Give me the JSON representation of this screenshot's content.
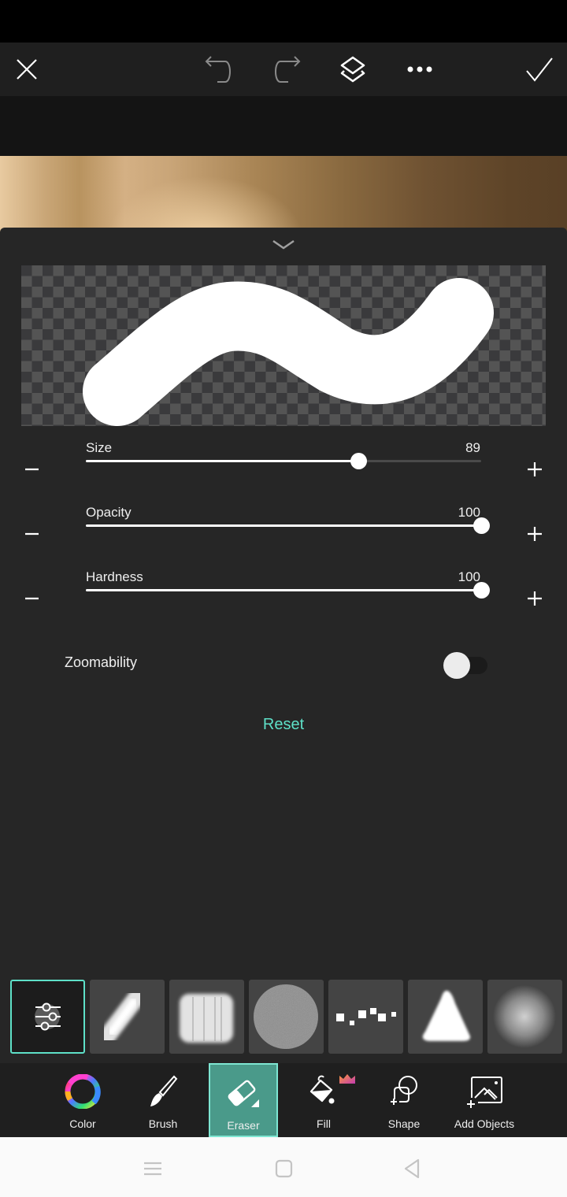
{
  "toolbar": {
    "close_icon": "close-icon",
    "undo_icon": "undo-icon",
    "redo_icon": "redo-icon",
    "layers_icon": "layers-icon",
    "more_icon": "more-horizontal-icon",
    "apply_icon": "checkmark-icon"
  },
  "panel": {
    "collapse_icon": "chevron-down-icon",
    "sliders": [
      {
        "label": "Size",
        "value": "89",
        "fraction": 0.69
      },
      {
        "label": "Opacity",
        "value": "100",
        "fraction": 1.0
      },
      {
        "label": "Hardness",
        "value": "100",
        "fraction": 1.0
      }
    ],
    "zoomability": {
      "label": "Zoomability",
      "enabled": false
    },
    "reset_label": "Reset"
  },
  "brush_presets": [
    {
      "name": "settings",
      "selected": true
    },
    {
      "name": "chalk-stroke"
    },
    {
      "name": "dry-brush"
    },
    {
      "name": "noise-circle"
    },
    {
      "name": "scatter-squares"
    },
    {
      "name": "rough-triangle"
    },
    {
      "name": "soft-round"
    }
  ],
  "tools": [
    {
      "label": "Color",
      "icon": "color-wheel-icon"
    },
    {
      "label": "Brush",
      "icon": "brush-icon"
    },
    {
      "label": "Eraser",
      "icon": "eraser-icon",
      "active": true
    },
    {
      "label": "Fill",
      "icon": "fill-bucket-icon",
      "premium": true
    },
    {
      "label": "Shape",
      "icon": "shape-icon"
    },
    {
      "label": "Add Objects",
      "icon": "add-image-icon"
    }
  ],
  "colors": {
    "accent": "#5ee0c8",
    "active_tool_bg": "#4a9a8a",
    "panel_bg": "#262626",
    "toolbar_bg": "#1f1f1f"
  }
}
